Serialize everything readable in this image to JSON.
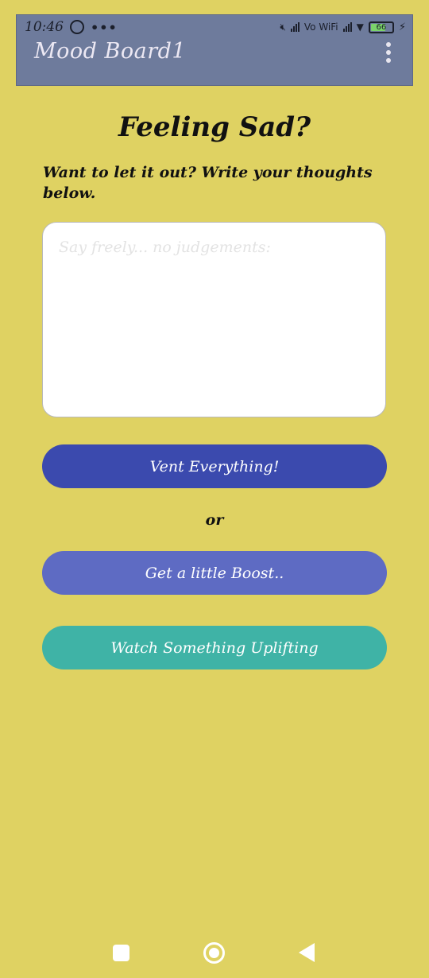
{
  "status_bar": {
    "time": "10:46",
    "more": "•••",
    "network_label": "Vo WiFi",
    "battery_level": "66",
    "icons": [
      "whatsapp-icon",
      "mute-icon",
      "signal-icon",
      "vowifi-icon",
      "wifi-icon",
      "battery-icon",
      "charging-icon"
    ]
  },
  "app_bar": {
    "title": "Mood Board1",
    "menu_icon": "overflow-menu-icon"
  },
  "main": {
    "heading": "Feeling Sad?",
    "prompt": "Want to let it out? Write your thoughts below.",
    "textarea_placeholder": "Say freely... no judgements:",
    "textarea_value": "",
    "vent_button": "Vent Everything!",
    "or_label": "or",
    "boost_button": "Get a little Boost..",
    "watch_button": "Watch Something Uplifting"
  },
  "nav_bar": {
    "icons": [
      "recents-icon",
      "home-icon",
      "back-icon"
    ]
  },
  "colors": {
    "background": "#dfd262",
    "app_bar": "#6e7b9c",
    "vent_button": "#3b4aae",
    "boost_button": "#5e6bc3",
    "watch_button": "#3fb3a6"
  }
}
